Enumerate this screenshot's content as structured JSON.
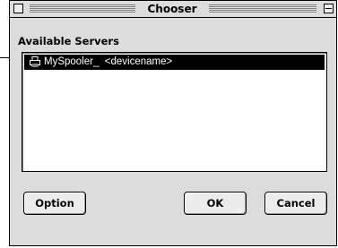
{
  "window": {
    "title": "Chooser"
  },
  "servers": {
    "label": "Available Servers",
    "items": [
      {
        "icon": "printer-icon",
        "label": "MySpooler_  <devicename>",
        "selected": true
      }
    ]
  },
  "buttons": {
    "option": "Option",
    "ok": "OK",
    "cancel": "Cancel"
  },
  "colors": {
    "window_bg": "#dcdcdc",
    "selection_bg": "#000000",
    "selection_fg": "#ffffff"
  }
}
